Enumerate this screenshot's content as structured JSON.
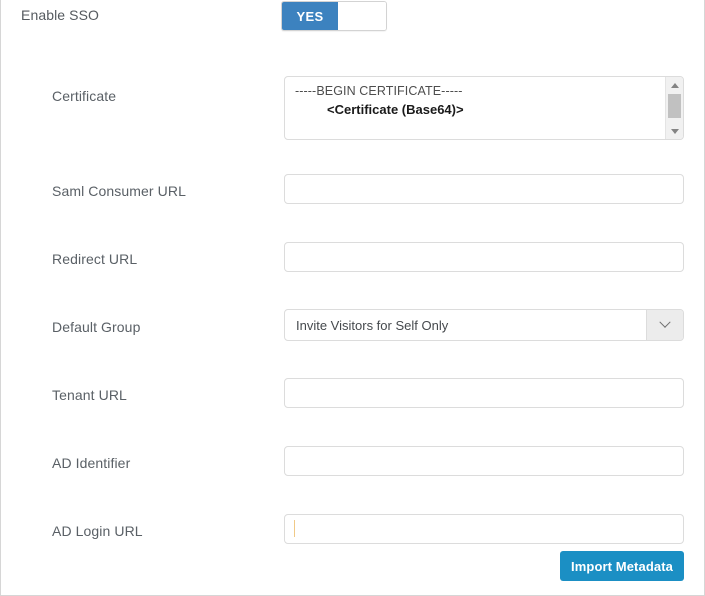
{
  "sso": {
    "label": "Enable SSO",
    "toggle_on_label": "YES",
    "toggle_state": "on",
    "accent_color": "#3c82bf"
  },
  "certificate": {
    "label": "Certificate",
    "line1": "-----BEGIN CERTIFICATE-----",
    "line2": "<Certificate (Base64)>",
    "scroll_up_icon": "triangle-up-icon",
    "scroll_down_icon": "triangle-down-icon"
  },
  "fields": {
    "saml_consumer_url": {
      "label": "Saml Consumer URL",
      "value": "",
      "placeholder": ""
    },
    "redirect_url": {
      "label": "Redirect URL",
      "value": "",
      "placeholder": ""
    },
    "default_group": {
      "label": "Default Group",
      "selected": "Invite Visitors for Self Only",
      "arrow_icon": "chevron-down-icon"
    },
    "tenant_url": {
      "label": "Tenant URL",
      "value": "",
      "placeholder": ""
    },
    "ad_identifier": {
      "label": "AD Identifier",
      "value": "",
      "placeholder": ""
    },
    "ad_login_url": {
      "label": "AD Login URL",
      "value": "",
      "placeholder": "",
      "focused": true
    }
  },
  "actions": {
    "import_metadata_label": "Import Metadata",
    "import_metadata_color": "#1b8fc4"
  }
}
